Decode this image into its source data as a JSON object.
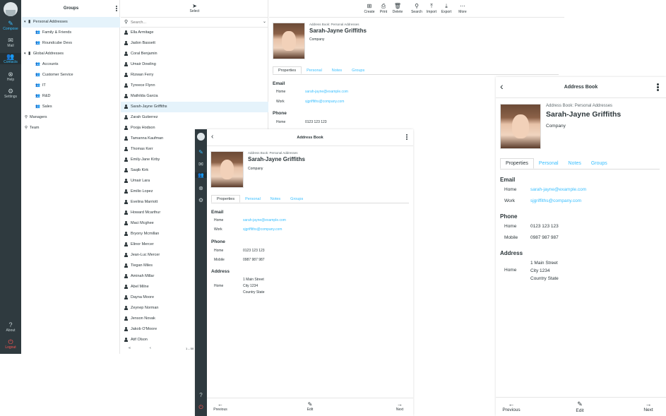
{
  "taskmenu": {
    "items": [
      {
        "label": "Compose",
        "icon": "compose-icon"
      },
      {
        "label": "Mail",
        "icon": "mail-icon"
      },
      {
        "label": "Contacts",
        "icon": "contacts-icon"
      },
      {
        "label": "Help",
        "icon": "help-icon"
      },
      {
        "label": "Settings",
        "icon": "settings-icon"
      },
      {
        "label": "About",
        "icon": "about-icon"
      },
      {
        "label": "Logout",
        "icon": "logout-icon"
      }
    ]
  },
  "groups": {
    "title": "Groups",
    "items": [
      {
        "label": "Personal Addresses"
      },
      {
        "label": "Family & Friends"
      },
      {
        "label": "Roundcube Devs"
      },
      {
        "label": "Global Addresses"
      },
      {
        "label": "Accounts"
      },
      {
        "label": "Customer Service"
      },
      {
        "label": "IT"
      },
      {
        "label": "R&D"
      },
      {
        "label": "Sales"
      },
      {
        "label": "Managers"
      },
      {
        "label": "Team"
      }
    ]
  },
  "list": {
    "select_label": "Select",
    "search_placeholder": "Search...",
    "contacts": [
      "Ella Armitage",
      "Jadon Bassett",
      "Coral Benjamin",
      "Umair Dowling",
      "Rizwan Ferry",
      "Tyreece Flynn",
      "Mathilda Garcia",
      "Sarah-Jayne Griffiths",
      "Zarah Gutierrez",
      "Pooja Hodson",
      "Tamanna Kaufman",
      "Thomas Kerr",
      "Emily-Jane Kirby",
      "Saqib Kirk",
      "Umair Lara",
      "Emilio Lopez",
      "Evelina Marriott",
      "Howard Mcarthur",
      "Maci Mcghee",
      "Bryony Mcmillan",
      "Elinor Mercer",
      "Jean-Luc Mercer",
      "Tiegan Miles",
      "Aminah Millar",
      "Abel Milne",
      "Dayna Moore",
      "Zeynep Norman",
      "Jenson Novak",
      "Jakob O'Moore",
      "Atif Olson"
    ],
    "pager_first": "«",
    "pager_prev": "‹",
    "pager_count": "1 – 50"
  },
  "toolbar": {
    "buttons": [
      "Create",
      "Print",
      "Delete",
      "Search",
      "Import",
      "Export",
      "More"
    ]
  },
  "contact": {
    "book": "Address Book: Personal Addresses",
    "name": "Sarah-Jayne Griffiths",
    "company": "Company",
    "tabs": [
      "Properties",
      "Personal",
      "Notes",
      "Groups"
    ],
    "email_title": "Email",
    "email_home_label": "Home",
    "email_home": "sarah-jayne@example.com",
    "email_work_label": "Work",
    "email_work": "sjgriffiths@company.com",
    "phone_title": "Phone",
    "phone_home_label": "Home",
    "phone_home": "0123 123 123",
    "phone_mobile_label": "Mobile",
    "phone_mobile": "0987 987 987",
    "address_title": "Address",
    "address_home_label": "Home",
    "address_line1": "1 Main Street",
    "address_line2": "City 1234",
    "address_line3": "Country State"
  },
  "mobile": {
    "header_title": "Address Book",
    "footer": {
      "previous": "Previous",
      "edit": "Edit",
      "next": "Next"
    }
  },
  "colors": {
    "accent": "#37beff",
    "sidebar": "#2f3a3f",
    "logout": "#ff5552",
    "selected_row": "#e5f3fb"
  }
}
